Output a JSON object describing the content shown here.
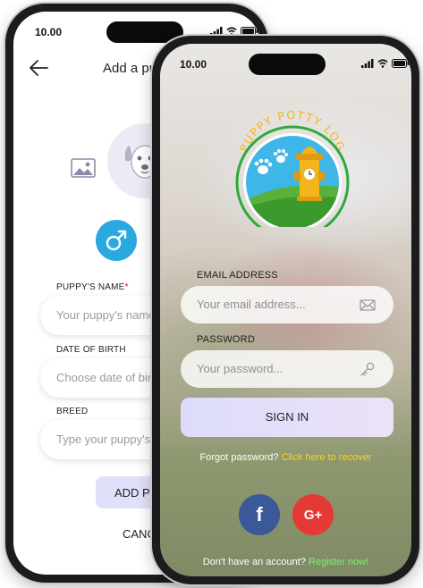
{
  "status_bar": {
    "time": "10.00"
  },
  "add_puppy_screen": {
    "title": "Add a puppy",
    "name_label": "PUPPY'S NAME",
    "required_mark": "*",
    "name_placeholder": "Your puppy's name...",
    "dob_label": "DATE OF BIRTH",
    "dob_placeholder": "Choose date of birth",
    "breed_label": "BREED",
    "breed_placeholder": "Type your puppy's breed",
    "add_button": "ADD PUPPY",
    "cancel_button": "CANCEL",
    "colors": {
      "male": "#29a9df",
      "female": "#e2387a"
    }
  },
  "login_screen": {
    "logo_text": "PUPPY POTTY LOG",
    "email_label": "EMAIL ADDRESS",
    "email_placeholder": "Your email address...",
    "password_label": "PASSWORD",
    "password_placeholder": "Your password...",
    "sign_in": "SIGN IN",
    "forgot_prefix": "Forgot password?",
    "forgot_link": "Click here to recover",
    "no_account": "Don't have an account?",
    "register_link": "Register now!",
    "social": {
      "facebook": "f",
      "google": "G+"
    },
    "colors": {
      "facebook": "#3b5998",
      "google": "#e53935",
      "link_yellow": "#ffd600",
      "link_green": "#7cf26a"
    }
  }
}
